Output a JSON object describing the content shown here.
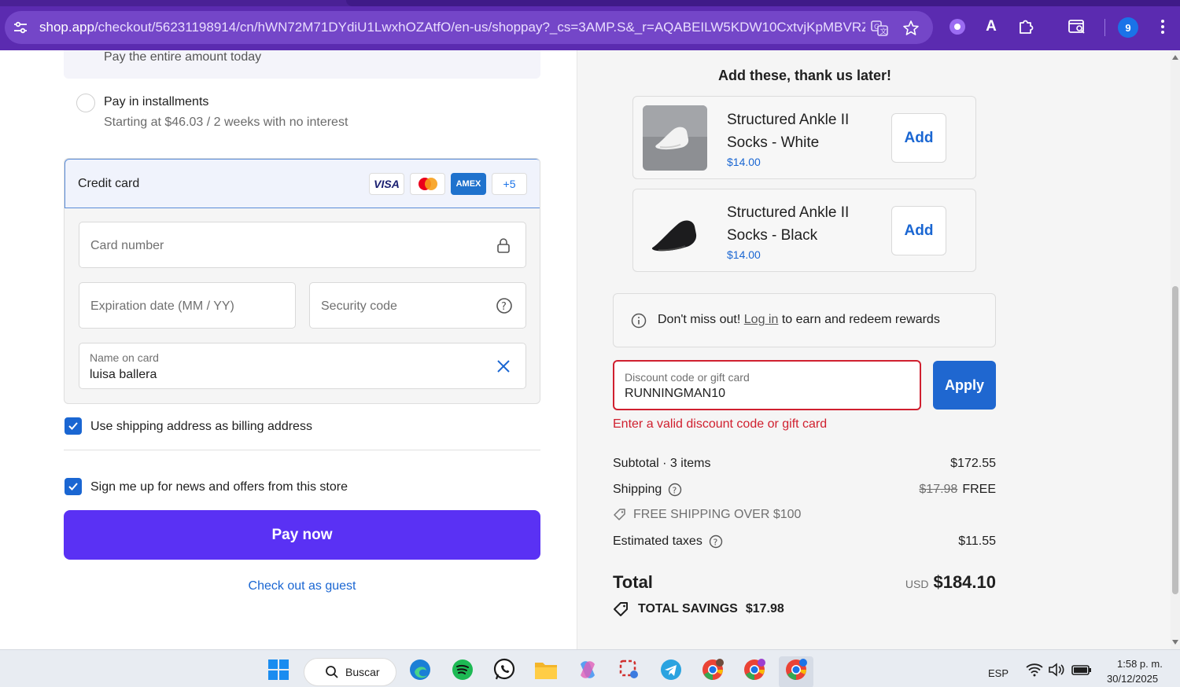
{
  "browser": {
    "url_host": "shop.app",
    "url_path": "/checkout/56231198914/cn/hWN72M71DYdiU1LwxhOZAtfO/en-us/shoppay?_cs=3AMP.S&_r=AQABEILW5KDW10CxtvjKpMBVRZ...",
    "avatar_letter": "9"
  },
  "payment": {
    "pay_full_text": "Pay the entire amount today",
    "installments_title": "Pay in installments",
    "installments_sub": "Starting at $46.03 / 2 weeks with no interest",
    "credit_card_label": "Credit card",
    "card_logos": {
      "visa": "VISA",
      "amex": "AMEX",
      "more": "+5"
    },
    "card_number_placeholder": "Card number",
    "expiration_placeholder": "Expiration date (MM / YY)",
    "security_placeholder": "Security code",
    "name_label": "Name on card",
    "name_value": "luisa ballera",
    "billing_checkbox": "Use shipping address as billing address",
    "news_checkbox": "Sign me up for news and offers from this store",
    "pay_now": "Pay now",
    "guest_link": "Check out as guest"
  },
  "summary": {
    "upsell_title": "Add these, thank us later!",
    "products": [
      {
        "name": "Structured Ankle II Socks - White",
        "price": "$14.00",
        "add": "Add"
      },
      {
        "name": "Structured Ankle II Socks - Black",
        "price": "$14.00",
        "add": "Add"
      }
    ],
    "rewards_prefix": "Don't miss out!",
    "rewards_link": "Log in",
    "rewards_suffix": "to earn and redeem rewards",
    "discount_label": "Discount code or gift card",
    "discount_value": "RUNNINGMAN10",
    "apply": "Apply",
    "error": "Enter a valid discount code or gift card",
    "subtotal_label": "Subtotal · 3 items",
    "subtotal_value": "$172.55",
    "shipping_label": "Shipping",
    "shipping_old": "$17.98",
    "shipping_value": "FREE",
    "shipping_tag": "FREE SHIPPING OVER $100",
    "taxes_label": "Estimated taxes",
    "taxes_value": "$11.55",
    "total_label": "Total",
    "total_currency": "USD",
    "total_value": "$184.10",
    "savings_label": "TOTAL SAVINGS",
    "savings_value": "$17.98"
  },
  "taskbar": {
    "search": "Buscar",
    "lang": "ESP",
    "time": "1:58 p. m.",
    "date": "30/12/2025"
  },
  "colors": {
    "browser": "#5b2bb0",
    "pay_button": "#5a31f4",
    "link": "#1a66d2",
    "error": "#d0202f"
  }
}
